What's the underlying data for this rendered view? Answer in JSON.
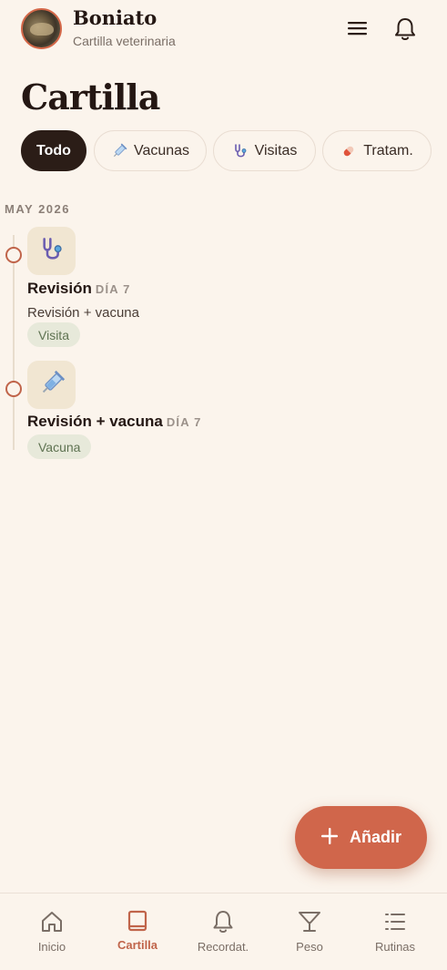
{
  "header": {
    "pet_name": "Boniato",
    "subtitle": "Cartilla veterinaria",
    "menu_icon": "hamburger-icon",
    "bell_icon": "bell-icon"
  },
  "page": {
    "title": "Cartilla"
  },
  "filters": [
    {
      "label": "Todo",
      "active": true
    },
    {
      "label": "Vacunas",
      "icon": "syringe-icon"
    },
    {
      "label": "Visitas",
      "icon": "stethoscope-icon"
    },
    {
      "label": "Tratam.",
      "icon": "pill-icon"
    }
  ],
  "timeline": {
    "month": "MAY 2026",
    "entries": [
      {
        "icon": "stethoscope-icon",
        "title": "Revisión",
        "day": "DÍA 7",
        "description": "Revisión + vacuna",
        "tag": "Visita"
      },
      {
        "icon": "syringe-icon",
        "title": "Revisión + vacuna",
        "day": "DÍA 7",
        "tag": "Vacuna"
      }
    ]
  },
  "fab": {
    "label": "Añadir",
    "icon": "plus-icon"
  },
  "nav": [
    {
      "label": "Inicio",
      "icon": "home-icon"
    },
    {
      "label": "Cartilla",
      "icon": "book-icon",
      "active": true
    },
    {
      "label": "Recordat.",
      "icon": "bell-icon"
    },
    {
      "label": "Peso",
      "icon": "scale-icon"
    },
    {
      "label": "Rutinas",
      "icon": "list-icon"
    }
  ],
  "colors": {
    "background": "#fbf4ec",
    "accent": "#d0664b",
    "dark": "#2b1d17",
    "tag_bg": "#e7e9da",
    "tag_text": "#5f7352"
  }
}
